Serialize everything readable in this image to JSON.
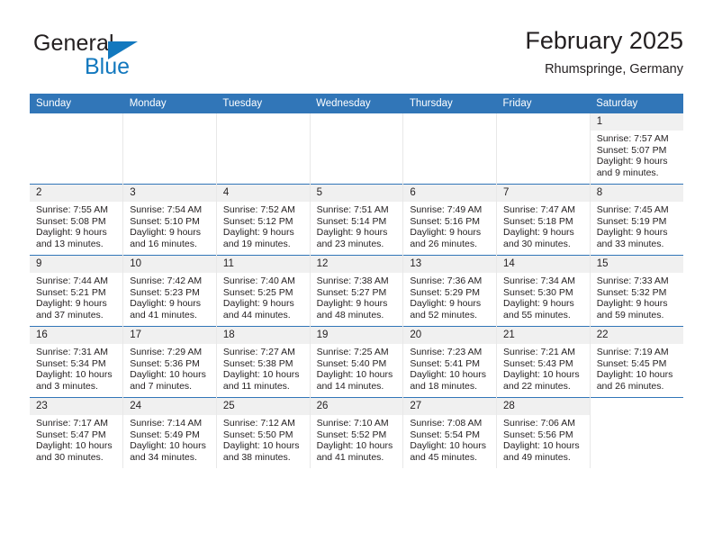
{
  "brand": {
    "name_top": "General",
    "name_bottom": "Blue",
    "triangle_color": "#1278be",
    "text_color": "#231f20"
  },
  "header": {
    "title": "February 2025",
    "subtitle": "Rhumspringe, Germany",
    "accent_color": "#3176b8"
  },
  "calendar": {
    "weekday_headers": [
      "Sunday",
      "Monday",
      "Tuesday",
      "Wednesday",
      "Thursday",
      "Friday",
      "Saturday"
    ],
    "weeks": [
      [
        {
          "day": "",
          "empty": true
        },
        {
          "day": "",
          "empty": true
        },
        {
          "day": "",
          "empty": true
        },
        {
          "day": "",
          "empty": true
        },
        {
          "day": "",
          "empty": true
        },
        {
          "day": "",
          "empty": true
        },
        {
          "day": "1",
          "sunrise": "Sunrise: 7:57 AM",
          "sunset": "Sunset: 5:07 PM",
          "daylight": "Daylight: 9 hours and 9 minutes."
        }
      ],
      [
        {
          "day": "2",
          "sunrise": "Sunrise: 7:55 AM",
          "sunset": "Sunset: 5:08 PM",
          "daylight": "Daylight: 9 hours and 13 minutes."
        },
        {
          "day": "3",
          "sunrise": "Sunrise: 7:54 AM",
          "sunset": "Sunset: 5:10 PM",
          "daylight": "Daylight: 9 hours and 16 minutes."
        },
        {
          "day": "4",
          "sunrise": "Sunrise: 7:52 AM",
          "sunset": "Sunset: 5:12 PM",
          "daylight": "Daylight: 9 hours and 19 minutes."
        },
        {
          "day": "5",
          "sunrise": "Sunrise: 7:51 AM",
          "sunset": "Sunset: 5:14 PM",
          "daylight": "Daylight: 9 hours and 23 minutes."
        },
        {
          "day": "6",
          "sunrise": "Sunrise: 7:49 AM",
          "sunset": "Sunset: 5:16 PM",
          "daylight": "Daylight: 9 hours and 26 minutes."
        },
        {
          "day": "7",
          "sunrise": "Sunrise: 7:47 AM",
          "sunset": "Sunset: 5:18 PM",
          "daylight": "Daylight: 9 hours and 30 minutes."
        },
        {
          "day": "8",
          "sunrise": "Sunrise: 7:45 AM",
          "sunset": "Sunset: 5:19 PM",
          "daylight": "Daylight: 9 hours and 33 minutes."
        }
      ],
      [
        {
          "day": "9",
          "sunrise": "Sunrise: 7:44 AM",
          "sunset": "Sunset: 5:21 PM",
          "daylight": "Daylight: 9 hours and 37 minutes."
        },
        {
          "day": "10",
          "sunrise": "Sunrise: 7:42 AM",
          "sunset": "Sunset: 5:23 PM",
          "daylight": "Daylight: 9 hours and 41 minutes."
        },
        {
          "day": "11",
          "sunrise": "Sunrise: 7:40 AM",
          "sunset": "Sunset: 5:25 PM",
          "daylight": "Daylight: 9 hours and 44 minutes."
        },
        {
          "day": "12",
          "sunrise": "Sunrise: 7:38 AM",
          "sunset": "Sunset: 5:27 PM",
          "daylight": "Daylight: 9 hours and 48 minutes."
        },
        {
          "day": "13",
          "sunrise": "Sunrise: 7:36 AM",
          "sunset": "Sunset: 5:29 PM",
          "daylight": "Daylight: 9 hours and 52 minutes."
        },
        {
          "day": "14",
          "sunrise": "Sunrise: 7:34 AM",
          "sunset": "Sunset: 5:30 PM",
          "daylight": "Daylight: 9 hours and 55 minutes."
        },
        {
          "day": "15",
          "sunrise": "Sunrise: 7:33 AM",
          "sunset": "Sunset: 5:32 PM",
          "daylight": "Daylight: 9 hours and 59 minutes."
        }
      ],
      [
        {
          "day": "16",
          "sunrise": "Sunrise: 7:31 AM",
          "sunset": "Sunset: 5:34 PM",
          "daylight": "Daylight: 10 hours and 3 minutes."
        },
        {
          "day": "17",
          "sunrise": "Sunrise: 7:29 AM",
          "sunset": "Sunset: 5:36 PM",
          "daylight": "Daylight: 10 hours and 7 minutes."
        },
        {
          "day": "18",
          "sunrise": "Sunrise: 7:27 AM",
          "sunset": "Sunset: 5:38 PM",
          "daylight": "Daylight: 10 hours and 11 minutes."
        },
        {
          "day": "19",
          "sunrise": "Sunrise: 7:25 AM",
          "sunset": "Sunset: 5:40 PM",
          "daylight": "Daylight: 10 hours and 14 minutes."
        },
        {
          "day": "20",
          "sunrise": "Sunrise: 7:23 AM",
          "sunset": "Sunset: 5:41 PM",
          "daylight": "Daylight: 10 hours and 18 minutes."
        },
        {
          "day": "21",
          "sunrise": "Sunrise: 7:21 AM",
          "sunset": "Sunset: 5:43 PM",
          "daylight": "Daylight: 10 hours and 22 minutes."
        },
        {
          "day": "22",
          "sunrise": "Sunrise: 7:19 AM",
          "sunset": "Sunset: 5:45 PM",
          "daylight": "Daylight: 10 hours and 26 minutes."
        }
      ],
      [
        {
          "day": "23",
          "sunrise": "Sunrise: 7:17 AM",
          "sunset": "Sunset: 5:47 PM",
          "daylight": "Daylight: 10 hours and 30 minutes."
        },
        {
          "day": "24",
          "sunrise": "Sunrise: 7:14 AM",
          "sunset": "Sunset: 5:49 PM",
          "daylight": "Daylight: 10 hours and 34 minutes."
        },
        {
          "day": "25",
          "sunrise": "Sunrise: 7:12 AM",
          "sunset": "Sunset: 5:50 PM",
          "daylight": "Daylight: 10 hours and 38 minutes."
        },
        {
          "day": "26",
          "sunrise": "Sunrise: 7:10 AM",
          "sunset": "Sunset: 5:52 PM",
          "daylight": "Daylight: 10 hours and 41 minutes."
        },
        {
          "day": "27",
          "sunrise": "Sunrise: 7:08 AM",
          "sunset": "Sunset: 5:54 PM",
          "daylight": "Daylight: 10 hours and 45 minutes."
        },
        {
          "day": "28",
          "sunrise": "Sunrise: 7:06 AM",
          "sunset": "Sunset: 5:56 PM",
          "daylight": "Daylight: 10 hours and 49 minutes."
        },
        {
          "day": "",
          "empty": true
        }
      ]
    ]
  }
}
